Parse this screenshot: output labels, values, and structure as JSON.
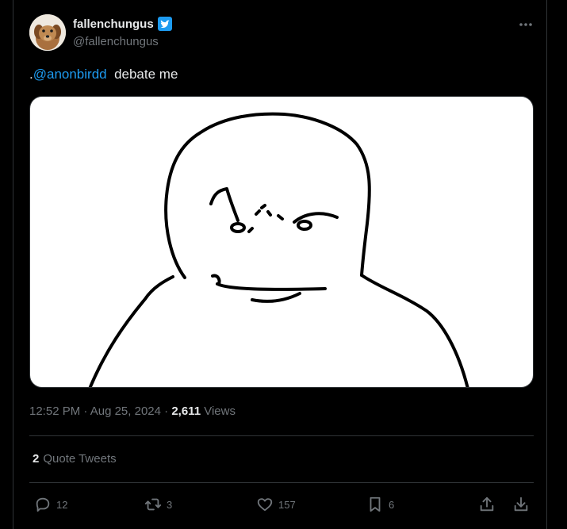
{
  "tweet": {
    "author": {
      "display_name": "fallenchungus",
      "handle": "@fallenchungus",
      "verified_badge": "verified-badge-icon",
      "avatar": "dog-avatar"
    },
    "text_prefix": ".",
    "mention": "@anonbirdd",
    "text_suffix": "  debate me",
    "time": "12:52 PM",
    "separator": " · ",
    "date": "Aug 25, 2024",
    "views_count": "2,611",
    "views_label": "Views",
    "quote_count": "2",
    "quote_label": "Quote Tweets",
    "actions": {
      "replies": "12",
      "retweets": "3",
      "likes": "157",
      "bookmarks": "6"
    }
  },
  "colors": {
    "background": "#000000",
    "text": "#e7e9ea",
    "secondary": "#71767b",
    "accent": "#1d9bf0",
    "border": "#2f3336"
  }
}
